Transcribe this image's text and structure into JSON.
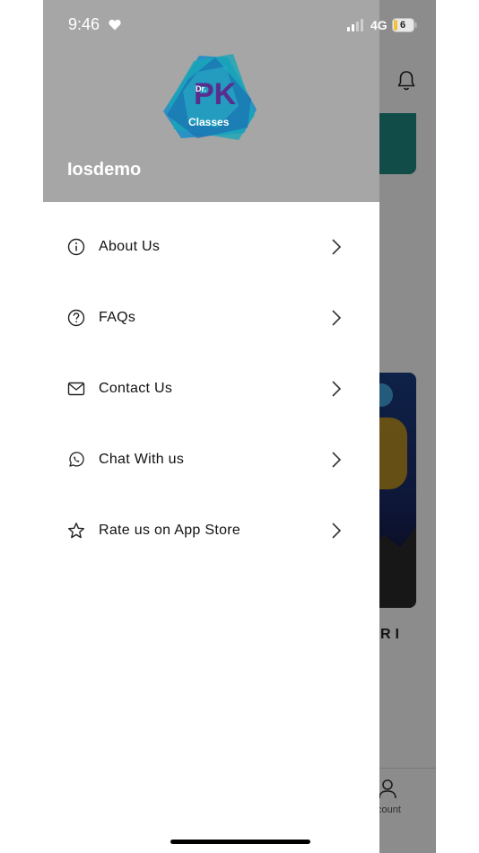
{
  "status_bar": {
    "time": "9:46",
    "network": "4G",
    "battery": "6"
  },
  "header": {
    "logo_dr": "Dr.",
    "logo_pk": "PK",
    "logo_classes": "Classes",
    "username": "Iosdemo"
  },
  "menu": {
    "items": [
      {
        "label": "About Us",
        "icon": "info-icon"
      },
      {
        "label": "FAQs",
        "icon": "question-icon"
      },
      {
        "label": "Contact Us",
        "icon": "mail-icon"
      },
      {
        "label": "Chat With us",
        "icon": "whatsapp-icon"
      },
      {
        "label": "Rate us on App Store",
        "icon": "star-icon"
      }
    ]
  },
  "background_app": {
    "caption_fragment": "RI",
    "tab_account_label": "count"
  },
  "colors": {
    "header_bg": "#a6a6a6",
    "overlay": "rgba(0,0,0,0.45)",
    "logo_teal": "#1a9fb0",
    "logo_purple": "#5a2c8e"
  }
}
